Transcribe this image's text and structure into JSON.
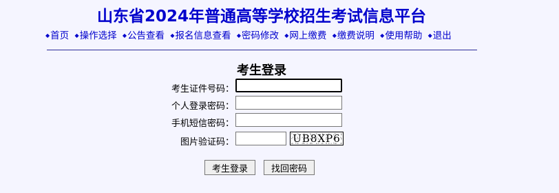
{
  "header": {
    "site_title": "山东省2024年普通高等学校招生考试信息平台"
  },
  "nav": {
    "items": [
      {
        "label": "首页"
      },
      {
        "label": "操作选择"
      },
      {
        "label": "公告查看"
      },
      {
        "label": "报名信息查看"
      },
      {
        "label": "密码修改"
      },
      {
        "label": "网上缴费"
      },
      {
        "label": "缴费说明"
      },
      {
        "label": "使用帮助"
      },
      {
        "label": "退出"
      }
    ],
    "bullet": "◆"
  },
  "login": {
    "title": "考生登录",
    "fields": {
      "id_number": {
        "label": "考生证件号码：",
        "value": ""
      },
      "password": {
        "label": "个人登录密码：",
        "value": ""
      },
      "sms_code": {
        "label": "手机短信密码：",
        "value": ""
      },
      "captcha": {
        "label": "图片验证码：",
        "value": "",
        "image_text": "UB8XP6"
      }
    },
    "buttons": {
      "login": "考生登录",
      "recover": "找回密码"
    }
  },
  "colors": {
    "title_blue": "#0000cc",
    "background": "#f5f5ff"
  }
}
